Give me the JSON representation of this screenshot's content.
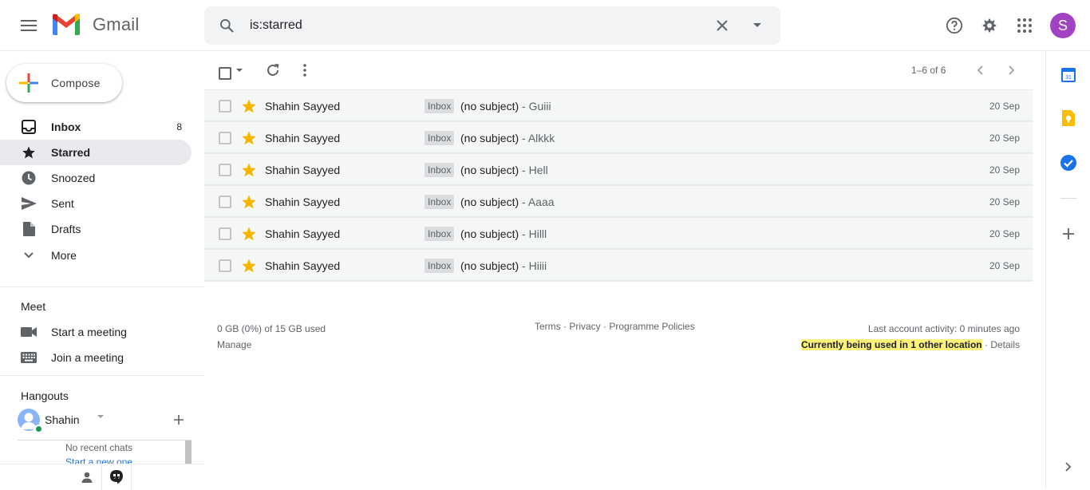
{
  "header": {
    "app_name": "Gmail",
    "search_value": "is:starred",
    "avatar_letter": "S"
  },
  "sidebar": {
    "compose_label": "Compose",
    "items": [
      {
        "label": "Inbox",
        "count": "8",
        "icon": "inbox-icon"
      },
      {
        "label": "Starred",
        "count": "",
        "icon": "star-icon"
      },
      {
        "label": "Snoozed",
        "count": "",
        "icon": "clock-icon"
      },
      {
        "label": "Sent",
        "count": "",
        "icon": "send-icon"
      },
      {
        "label": "Drafts",
        "count": "",
        "icon": "draft-icon"
      },
      {
        "label": "More",
        "count": "",
        "icon": "chevron-down-icon"
      }
    ],
    "meet": {
      "title": "Meet",
      "start": "Start a meeting",
      "join": "Join a meeting"
    },
    "hangouts": {
      "title": "Hangouts",
      "user": "Shahin",
      "empty": "No recent chats",
      "start_new": "Start a new one"
    }
  },
  "toolbar": {
    "pager": "1–6 of 6"
  },
  "emails": [
    {
      "sender": "Shahin Sayyed",
      "label": "Inbox",
      "subject": "(no subject)",
      "snippet": " - Guiii",
      "date": "20 Sep"
    },
    {
      "sender": "Shahin Sayyed",
      "label": "Inbox",
      "subject": "(no subject)",
      "snippet": " - Alkkk",
      "date": "20 Sep"
    },
    {
      "sender": "Shahin Sayyed",
      "label": "Inbox",
      "subject": "(no subject)",
      "snippet": " - Hell",
      "date": "20 Sep"
    },
    {
      "sender": "Shahin Sayyed",
      "label": "Inbox",
      "subject": "(no subject)",
      "snippet": " - Aaaa",
      "date": "20 Sep"
    },
    {
      "sender": "Shahin Sayyed",
      "label": "Inbox",
      "subject": "(no subject)",
      "snippet": " - Hilll",
      "date": "20 Sep"
    },
    {
      "sender": "Shahin Sayyed",
      "label": "Inbox",
      "subject": "(no subject)",
      "snippet": " - Hiiii",
      "date": "20 Sep"
    }
  ],
  "footer": {
    "storage": "0 GB (0%) of 15 GB used",
    "manage": "Manage",
    "terms": "Terms",
    "privacy": "Privacy",
    "policies": "Programme Policies",
    "sep": " · ",
    "activity": "Last account activity: 0 minutes ago",
    "location": "Currently being used in 1 other location",
    "details": "Details"
  },
  "colors": {
    "star": "#f4b400",
    "avatar": "#a142c2",
    "highlight": "#fdf17a"
  }
}
